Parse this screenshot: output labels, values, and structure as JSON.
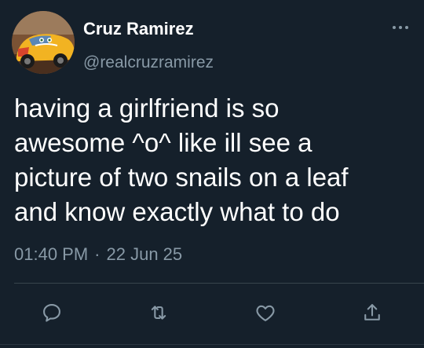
{
  "colors": {
    "background": "#15202b",
    "text_primary": "#ffffff",
    "text_secondary": "#8899a6",
    "divider": "#38444d"
  },
  "author": {
    "display_name": "Cruz Ramirez",
    "handle": "@realcruzramirez",
    "avatar_icon": "race-car-avatar"
  },
  "tweet": {
    "text": "having a girlfriend is so\nawesome ^o^ like ill see a\npicture of two snails on a leaf\nand know exactly what to do",
    "time": "01:40 PM",
    "separator": "·",
    "date": "22 Jun 25"
  },
  "actions": [
    {
      "name": "reply",
      "icon": "reply-icon"
    },
    {
      "name": "retweet",
      "icon": "retweet-icon"
    },
    {
      "name": "like",
      "icon": "heart-icon"
    },
    {
      "name": "share",
      "icon": "share-icon"
    }
  ]
}
